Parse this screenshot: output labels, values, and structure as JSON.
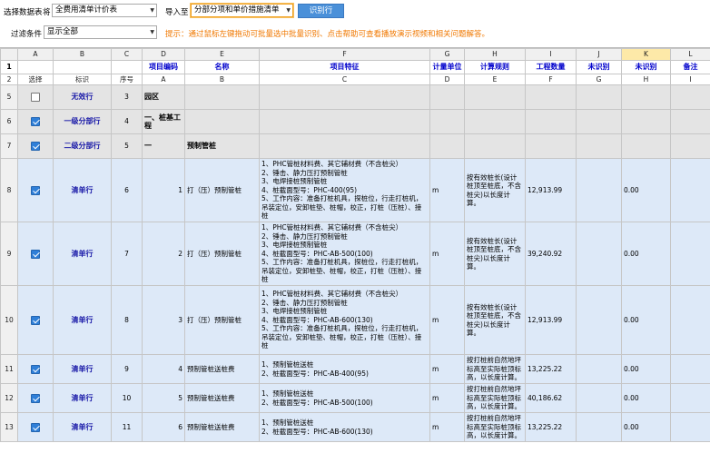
{
  "toolbar": {
    "select_label": "选择数据表",
    "select_suffix": "将",
    "table_value": "全费用清单计价表",
    "import_label": "导入至",
    "import_value": "分部分项和单价措施清单",
    "identify_button": "识别行",
    "filter_label": "过滤条件",
    "filter_value": "显示全部",
    "hint": "提示：通过鼠标左键拖动可批量选中批量识别、点击帮助可查看播放演示视频和相关问题解答。"
  },
  "grid": {
    "col_letters": [
      "A",
      "B",
      "C",
      "D",
      "E",
      "F",
      "G",
      "H",
      "I",
      "J",
      "K",
      "L"
    ],
    "field_headers": [
      "",
      "",
      "",
      "项目编码",
      "名称",
      "项目特征",
      "计量单位",
      "计算规则",
      "工程数量",
      "未识别",
      "未识别",
      "备注"
    ],
    "sub_headers": [
      "选择",
      "标识",
      "序号",
      "A",
      "B",
      "C",
      "D",
      "E",
      "F",
      "G",
      "H",
      "I"
    ],
    "rows": [
      {
        "row_num": "5",
        "checked": false,
        "tag": "无效行",
        "seq": "3",
        "code": "园区",
        "name": "",
        "feature": "",
        "unit": "",
        "rule": "",
        "qty": "",
        "g": "",
        "h": "",
        "style": "gray"
      },
      {
        "row_num": "6",
        "checked": true,
        "tag": "一级分部行",
        "seq": "4",
        "code": "一、桩基工程",
        "name": "",
        "feature": "",
        "unit": "",
        "rule": "",
        "qty": "",
        "g": "",
        "h": "",
        "style": "gray"
      },
      {
        "row_num": "7",
        "checked": true,
        "tag": "二级分部行",
        "seq": "5",
        "code": "一",
        "name": "预制管桩",
        "feature": "",
        "unit": "",
        "rule": "",
        "qty": "",
        "g": "",
        "h": "",
        "style": "gray"
      },
      {
        "row_num": "8",
        "checked": true,
        "tag": "清单行",
        "seq": "6",
        "code": "1",
        "name": "打（压）预制管桩",
        "feature": "1、PHC管桩材料费、其它辅材费（不含桩尖）\n2、锤击、静力压打预制管桩\n3、电焊接桩预制管桩\n4、桩截面型号：PHC-400(95)\n5、工作内容：准备打桩机具，探桩位，行走打桩机，吊装定位，安卸桩垫、桩帽，校正，打桩（压桩）、接桩",
        "unit": "m",
        "rule": "按有效桩长(设计桩顶至桩底，不含桩尖)以长度计算。",
        "qty": "12,913.99",
        "g": "",
        "h": "0.00",
        "style": "blue"
      },
      {
        "row_num": "9",
        "checked": true,
        "tag": "清单行",
        "seq": "7",
        "code": "2",
        "name": "打（压）预制管桩",
        "feature": "1、PHC管桩材料费、其它辅材费（不含桩尖）\n2、锤击、静力压打预制管桩\n3、电焊接桩预制管桩\n4、桩截面型号：PHC-AB-500(100)\n5、工作内容：准备打桩机具，探桩位，行走打桩机，吊装定位，安卸桩垫、桩帽，校正，打桩（压桩）、接桩",
        "unit": "m",
        "rule": "按有效桩长(设计桩顶至桩底，不含桩尖)以长度计算。",
        "qty": "39,240.92",
        "g": "",
        "h": "0.00",
        "style": "blue"
      },
      {
        "row_num": "10",
        "checked": true,
        "tag": "清单行",
        "seq": "8",
        "code": "3",
        "name": "打（压）预制管桩",
        "feature": "1、PHC管桩材料费、其它辅材费（不含桩尖）\n2、锤击、静力压打预制管桩\n3、电焊接桩预制管桩\n4、桩截面型号：PHC-AB-600(130)\n5、工作内容：准备打桩机具，探桩位，行走打桩机，吊装定位，安卸桩垫、桩帽，校正，打桩（压桩）、接桩",
        "unit": "m",
        "rule": "按有效桩长(设计桩顶至桩底，不含桩尖)以长度计算。",
        "qty": "12,913.99",
        "g": "",
        "h": "0.00",
        "style": "blue"
      },
      {
        "row_num": "11",
        "checked": true,
        "tag": "清单行",
        "seq": "9",
        "code": "4",
        "name": "预制管桩送桩费",
        "feature": "1、预制管桩送桩\n2、桩截面型号：PHC-AB-400(95)",
        "unit": "m",
        "rule": "按打桩前自然地坪标高至实际桩顶标高，以长度计算。",
        "qty": "13,225.22",
        "g": "",
        "h": "0.00",
        "style": "blue"
      },
      {
        "row_num": "12",
        "checked": true,
        "tag": "清单行",
        "seq": "10",
        "code": "5",
        "name": "预制管桩送桩费",
        "feature": "1、预制管桩送桩\n2、桩截面型号：PHC-AB-500(100)",
        "unit": "m",
        "rule": "按打桩前自然地坪标高至实际桩顶标高，以长度计算。",
        "qty": "40,186.62",
        "g": "",
        "h": "0.00",
        "style": "blue"
      },
      {
        "row_num": "13",
        "checked": true,
        "tag": "清单行",
        "seq": "11",
        "code": "6",
        "name": "预制管桩送桩费",
        "feature": "1、预制管桩送桩\n2、桩截面型号：PHC-AB-600(130)",
        "unit": "m",
        "rule": "按打桩前自然地坪标高至实际桩顶标高，以长度计算。",
        "qty": "13,225.22",
        "g": "",
        "h": "0.00",
        "style": "blue"
      }
    ]
  }
}
